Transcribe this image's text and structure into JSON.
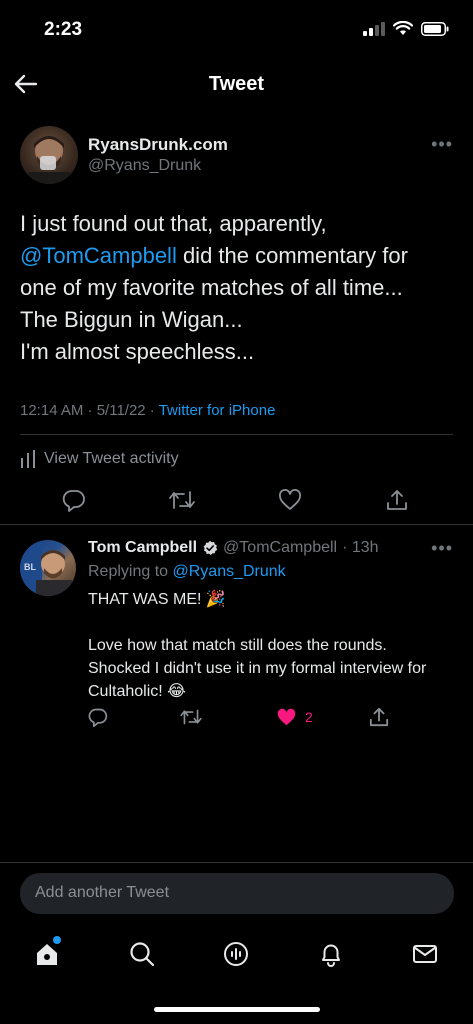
{
  "status_bar": {
    "time": "2:23"
  },
  "header": {
    "title": "Tweet"
  },
  "main_tweet": {
    "author_name": "RyansDrunk.com",
    "author_handle": "@Ryans_Drunk",
    "text_line1": "I just found out that, apparently,",
    "mention": "@TomCampbell",
    "text_line2_rest": " did the commentary for",
    "text_line3": "one of my favorite matches of all time...",
    "text_line4": "The Biggun in Wigan...",
    "text_line5": "I'm almost speechless...",
    "timestamp": "12:14 AM · 5/11/22 · ",
    "source": "Twitter for iPhone",
    "activity_label": "View Tweet activity"
  },
  "reply": {
    "author_name": "Tom Campbell",
    "author_handle": "@TomCampbell",
    "age": "· 13h",
    "replying_prefix": "Replying to ",
    "replying_handle": "@Ryans_Drunk",
    "line1": "THAT WAS ME! 🎉",
    "line2": "Love how that match still does the rounds.",
    "line3": "Shocked I didn't use it in my formal interview for",
    "line4": "Cultaholic! 😂",
    "like_count": "2"
  },
  "compose": {
    "placeholder": "Add another Tweet"
  },
  "icons": {
    "back": "arrow-left-icon",
    "more": "more-horizontal-icon",
    "reply": "speech-bubble-icon",
    "retweet": "retweet-icon",
    "like": "heart-icon",
    "share": "share-icon",
    "activity": "bar-chart-icon",
    "verified": "verified-badge-icon",
    "home": "home-icon",
    "search": "search-icon",
    "spaces": "spaces-icon",
    "notifications": "bell-icon",
    "messages": "envelope-icon"
  },
  "colors": {
    "accent": "#1d9bf0",
    "like": "#f91880",
    "muted": "#71767b",
    "background": "#000000"
  }
}
